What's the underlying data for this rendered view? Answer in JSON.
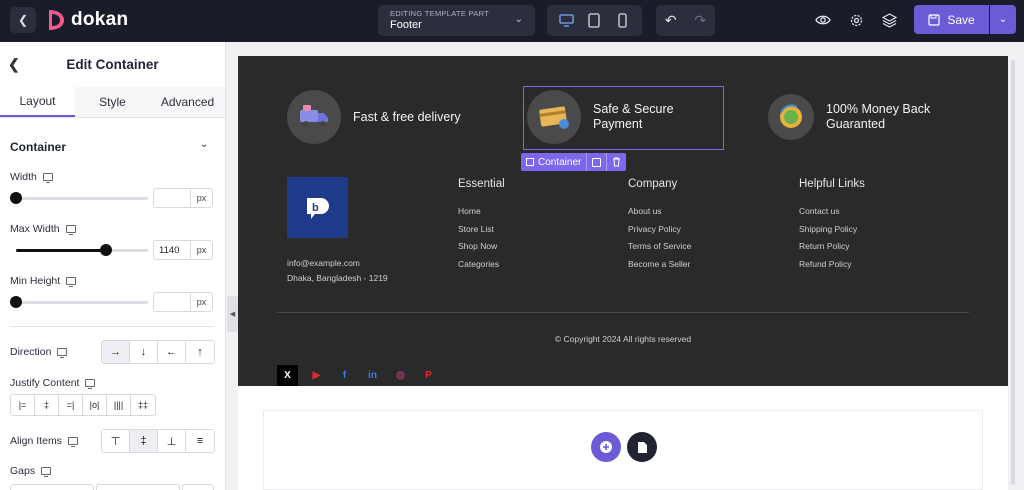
{
  "topbar": {
    "logo_text": "dokan",
    "editing_label": "EDITING TEMPLATE PART",
    "editing_value": "Footer",
    "save_label": "Save"
  },
  "panel": {
    "title": "Edit Container",
    "tabs": [
      "Layout",
      "Style",
      "Advanced"
    ],
    "section": "Container",
    "width_label": "Width",
    "width_value": "",
    "width_fraction": 0,
    "max_width_label": "Max Width",
    "max_width_value": "1140",
    "max_width_fraction": 0.68,
    "min_height_label": "Min Height",
    "min_height_value": "",
    "min_height_fraction": 0,
    "unit": "px",
    "direction_label": "Direction",
    "justify_label": "Justify Content",
    "align_label": "Align Items",
    "gaps_label": "Gaps",
    "direction_options": [
      "→",
      "↓",
      "←",
      "↑"
    ],
    "justify_options": [
      "|=",
      "‡",
      "=|",
      "|o|",
      "||||",
      "‡‡"
    ],
    "align_options": [
      "⊤",
      "‡",
      "⊥",
      "≡"
    ]
  },
  "footer": {
    "features": [
      {
        "text": "Fast & free delivery",
        "icon": "delivery-truck-icon"
      },
      {
        "text": "Safe & Secure\nPayment",
        "icon": "credit-card-icon"
      },
      {
        "text": "100% Money Back\nGuaranted",
        "icon": "money-back-icon"
      }
    ],
    "container_chip": "Container",
    "email": "info@example.com",
    "address": "Dhaka, Bangladesh - 1219",
    "columns": [
      {
        "title": "Essential",
        "links": [
          "Home",
          "Store List",
          "Shop Now",
          "Categories"
        ]
      },
      {
        "title": "Company",
        "links": [
          "About us",
          "Privacy Policy",
          "Terms of Service",
          "Become a Seller"
        ]
      },
      {
        "title": "Helpful Links",
        "links": [
          "Contact us",
          "Shipping Policy",
          "Return Policy",
          "Refund Policy"
        ]
      }
    ],
    "copyright": "© Copyright 2024 All rights reserved",
    "social": [
      {
        "name": "x-icon",
        "glyph": "X",
        "color": "#ffffff",
        "bg": "#000000"
      },
      {
        "name": "youtube-icon",
        "glyph": "▶",
        "color": "#e02a2a",
        "bg": "transparent"
      },
      {
        "name": "facebook-icon",
        "glyph": "f",
        "color": "#3b7be8",
        "bg": "transparent"
      },
      {
        "name": "linkedin-icon",
        "glyph": "in",
        "color": "#3b7be8",
        "bg": "transparent"
      },
      {
        "name": "instagram-icon",
        "glyph": "◎",
        "color": "#d6338a",
        "bg": "transparent"
      },
      {
        "name": "pinterest-icon",
        "glyph": "P",
        "color": "#e02a2a",
        "bg": "transparent"
      }
    ]
  },
  "colors": {
    "accent": "#6c5bd6",
    "topbar_bg": "#1a1d29",
    "footer_bg": "#2a2a2a"
  }
}
